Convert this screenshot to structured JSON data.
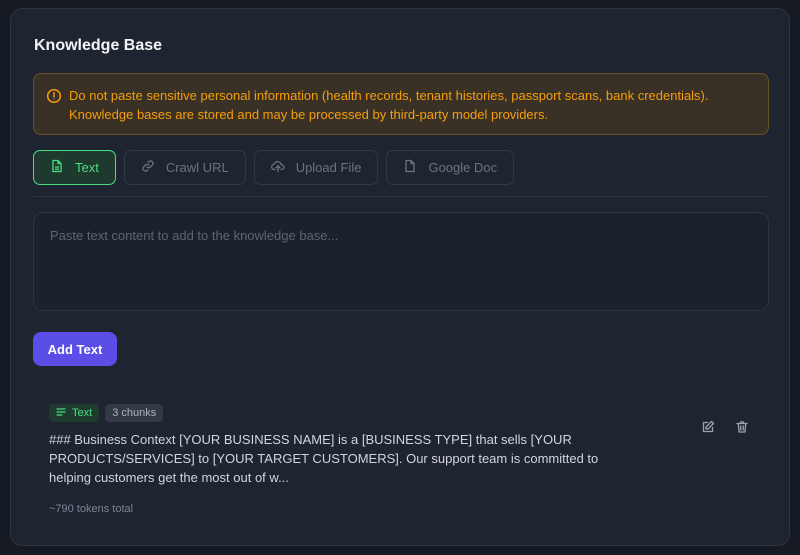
{
  "panel": {
    "title": "Knowledge Base"
  },
  "warning": {
    "icon": "alert-circle-icon",
    "text": "Do not paste sensitive personal information (health records, tenant histories, passport scans, bank credentials). Knowledge bases are stored and may be processed by third-party model providers."
  },
  "tabs": [
    {
      "label": "Text",
      "icon": "document-icon",
      "active": true
    },
    {
      "label": "Crawl URL",
      "icon": "link-icon",
      "active": false
    },
    {
      "label": "Upload File",
      "icon": "cloud-upload-icon",
      "active": false
    },
    {
      "label": "Google Doc",
      "icon": "file-icon",
      "active": false
    }
  ],
  "input": {
    "value": "",
    "placeholder": "Paste text content to add to the knowledge base..."
  },
  "add_button": {
    "label": "Add Text"
  },
  "entries": [
    {
      "type_label": "Text",
      "type_icon": "text-lines-icon",
      "chunks_label": "3 chunks",
      "preview": "### Business Context [YOUR BUSINESS NAME] is a [BUSINESS TYPE] that sells [YOUR PRODUCTS/SERVICES] to [YOUR TARGET CUSTOMERS]. Our support team is committed to helping customers get the most out of w...",
      "tokens_label": "~790 tokens total"
    }
  ],
  "colors": {
    "accent_green": "#4ade80",
    "warning_amber": "#f59e0b",
    "primary_button": "#5b4ee6",
    "panel_bg": "#1f2530"
  }
}
